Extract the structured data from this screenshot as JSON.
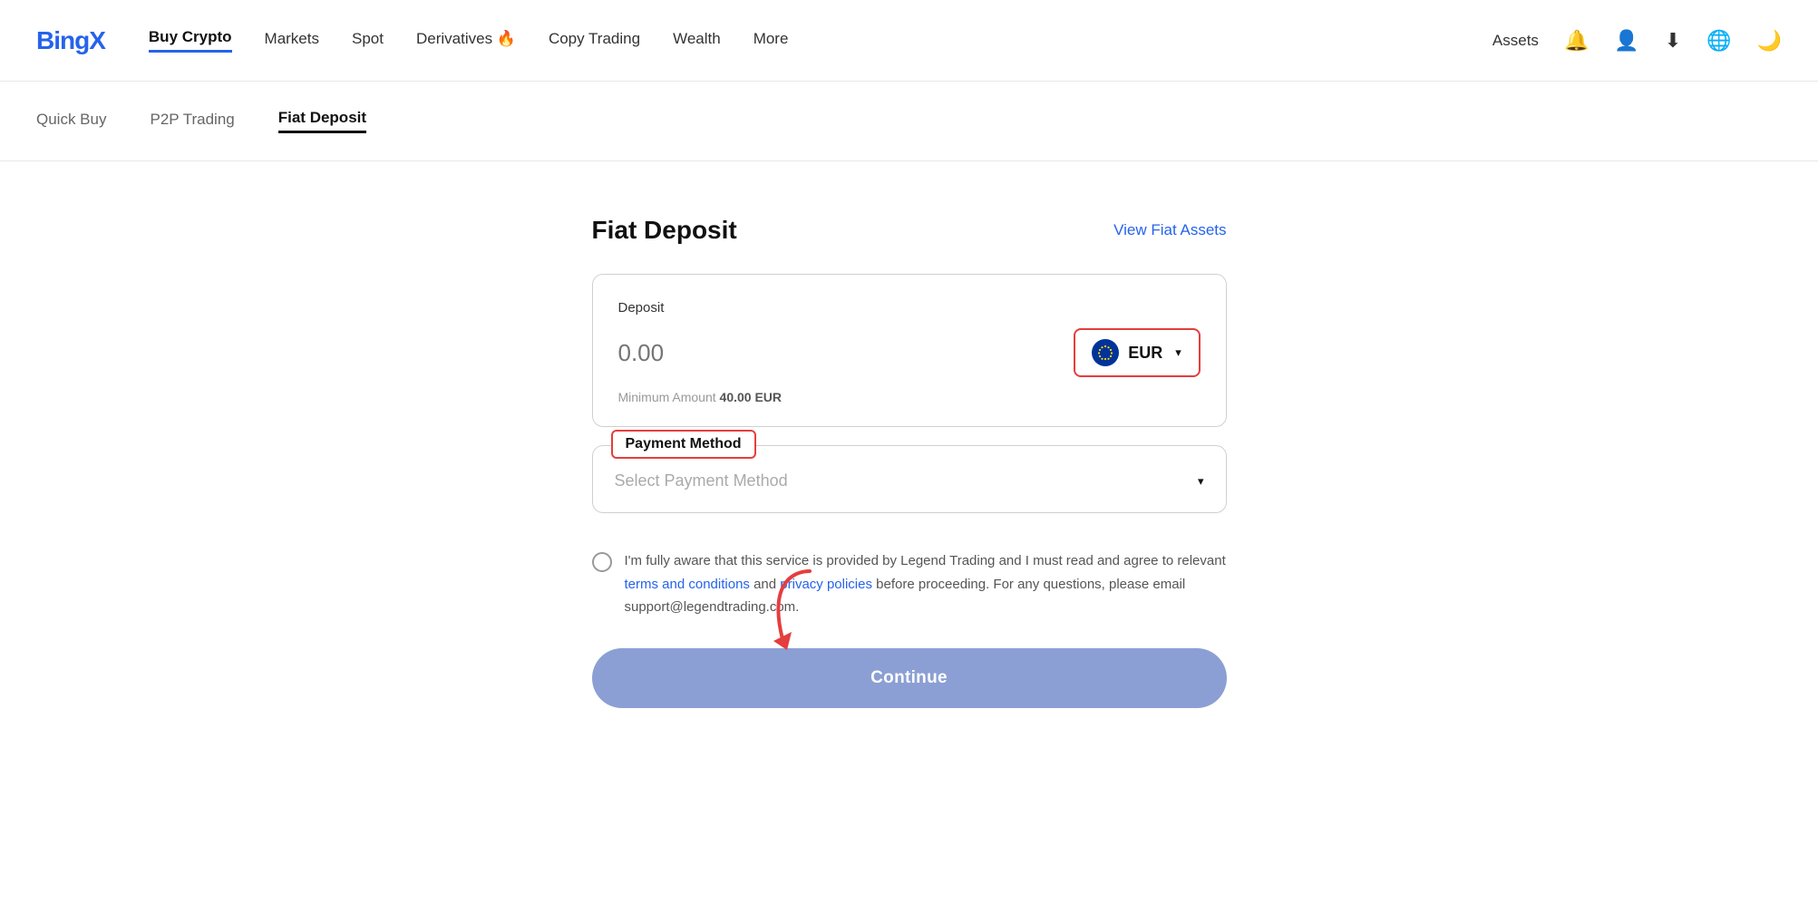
{
  "header": {
    "logo": "Bing",
    "logo_x": "x",
    "nav": {
      "items": [
        {
          "label": "Buy Crypto",
          "active": true
        },
        {
          "label": "Markets",
          "active": false
        },
        {
          "label": "Spot",
          "active": false
        },
        {
          "label": "Derivatives 🔥",
          "active": false
        },
        {
          "label": "Copy Trading",
          "active": false
        },
        {
          "label": "Wealth",
          "active": false
        },
        {
          "label": "More",
          "active": false
        }
      ]
    },
    "right": {
      "assets": "Assets"
    }
  },
  "tabs": [
    {
      "label": "Quick Buy",
      "active": false
    },
    {
      "label": "P2P Trading",
      "active": false
    },
    {
      "label": "Fiat Deposit",
      "active": true
    }
  ],
  "page": {
    "title": "Fiat Deposit",
    "view_assets": "View Fiat Assets"
  },
  "deposit": {
    "label": "Deposit",
    "placeholder": "0.00",
    "currency": "EUR",
    "min_amount_label": "Minimum Amount",
    "min_amount_value": "40.00 EUR"
  },
  "payment": {
    "label": "Payment Method",
    "placeholder": "Select Payment Method"
  },
  "disclaimer": {
    "text1": "I'm fully aware that this service is provided by Legend Trading and I must read and agree to relevant ",
    "terms_link": "terms and conditions",
    "text2": " and ",
    "privacy_link": "privacy policies",
    "text3": " before proceeding. For any questions, please email support@legendtrading.com."
  },
  "continue_button": {
    "label": "Continue"
  }
}
